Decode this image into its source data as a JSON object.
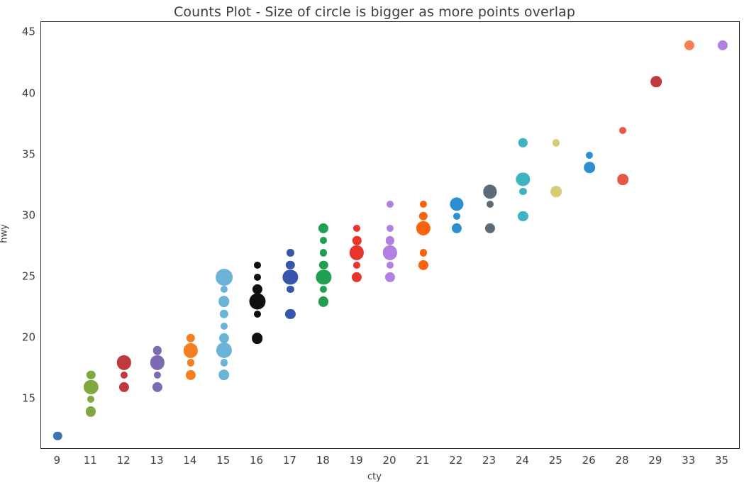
{
  "chart_data": {
    "type": "scatter",
    "title": "Counts Plot - Size of circle is bigger as more points overlap",
    "xlabel": "cty",
    "ylabel": "hwy",
    "grid": false,
    "legend": false,
    "x_is_categorical": true,
    "categories": [
      "9",
      "11",
      "12",
      "13",
      "14",
      "15",
      "16",
      "17",
      "18",
      "19",
      "20",
      "21",
      "22",
      "23",
      "24",
      "25",
      "26",
      "28",
      "29",
      "33",
      "35"
    ],
    "xtick_labels": [
      "9",
      "11",
      "12",
      "13",
      "14",
      "15",
      "16",
      "17",
      "18",
      "19",
      "20",
      "21",
      "22",
      "23",
      "24",
      "25",
      "26",
      "28",
      "29",
      "33",
      "35"
    ],
    "ytick_labels": [
      "15",
      "20",
      "25",
      "30",
      "35",
      "40",
      "45"
    ],
    "yticks": [
      15,
      20,
      25,
      30,
      35,
      40,
      45
    ],
    "ylim": [
      11.0,
      45.9
    ],
    "size_encodes": "count of overlapping points",
    "series": [
      {
        "name": "cty=9",
        "color": "#3b75af",
        "points": [
          {
            "x": "9",
            "y": 12,
            "count": 2
          }
        ]
      },
      {
        "name": "cty=11",
        "color": "#7fa93f",
        "points": [
          {
            "x": "11",
            "y": 17,
            "count": 2
          },
          {
            "x": "11",
            "y": 16,
            "count": 8
          },
          {
            "x": "11",
            "y": 15,
            "count": 1
          },
          {
            "x": "11",
            "y": 14,
            "count": 3
          }
        ]
      },
      {
        "name": "cty=12",
        "color": "#c0393f",
        "points": [
          {
            "x": "12",
            "y": 18,
            "count": 8
          },
          {
            "x": "12",
            "y": 17,
            "count": 1
          },
          {
            "x": "12",
            "y": 16,
            "count": 3
          }
        ]
      },
      {
        "name": "cty=13",
        "color": "#7d6ab2",
        "points": [
          {
            "x": "13",
            "y": 19,
            "count": 2
          },
          {
            "x": "13",
            "y": 18,
            "count": 8
          },
          {
            "x": "13",
            "y": 17,
            "count": 1
          },
          {
            "x": "13",
            "y": 16,
            "count": 3
          }
        ]
      },
      {
        "name": "cty=14",
        "color": "#f57f20",
        "points": [
          {
            "x": "14",
            "y": 20,
            "count": 2
          },
          {
            "x": "14",
            "y": 19,
            "count": 8
          },
          {
            "x": "14",
            "y": 18,
            "count": 1
          },
          {
            "x": "14",
            "y": 17,
            "count": 3
          }
        ]
      },
      {
        "name": "cty=15",
        "color": "#6cb4d7",
        "points": [
          {
            "x": "15",
            "y": 25,
            "count": 12
          },
          {
            "x": "15",
            "y": 24,
            "count": 1
          },
          {
            "x": "15",
            "y": 23,
            "count": 4
          },
          {
            "x": "15",
            "y": 22,
            "count": 2
          },
          {
            "x": "15",
            "y": 21,
            "count": 1
          },
          {
            "x": "15",
            "y": 20,
            "count": 3
          },
          {
            "x": "15",
            "y": 19,
            "count": 10
          },
          {
            "x": "15",
            "y": 18,
            "count": 1
          },
          {
            "x": "15",
            "y": 17,
            "count": 4
          }
        ]
      },
      {
        "name": "cty=16",
        "color": "#101010",
        "points": [
          {
            "x": "16",
            "y": 26,
            "count": 1
          },
          {
            "x": "16",
            "y": 25,
            "count": 1
          },
          {
            "x": "16",
            "y": 24,
            "count": 3
          },
          {
            "x": "16",
            "y": 23,
            "count": 11
          },
          {
            "x": "16",
            "y": 22,
            "count": 1
          },
          {
            "x": "16",
            "y": 20,
            "count": 4
          }
        ]
      },
      {
        "name": "cty=17",
        "color": "#3656ac",
        "points": [
          {
            "x": "17",
            "y": 27,
            "count": 1
          },
          {
            "x": "17",
            "y": 26,
            "count": 2
          },
          {
            "x": "17",
            "y": 25,
            "count": 9
          },
          {
            "x": "17",
            "y": 24,
            "count": 1
          },
          {
            "x": "17",
            "y": 22,
            "count": 3
          }
        ]
      },
      {
        "name": "cty=18",
        "color": "#22a052",
        "points": [
          {
            "x": "18",
            "y": 29,
            "count": 3
          },
          {
            "x": "18",
            "y": 28,
            "count": 1
          },
          {
            "x": "18",
            "y": 27,
            "count": 1
          },
          {
            "x": "18",
            "y": 26,
            "count": 2
          },
          {
            "x": "18",
            "y": 25,
            "count": 9
          },
          {
            "x": "18",
            "y": 24,
            "count": 1
          },
          {
            "x": "18",
            "y": 23,
            "count": 3
          }
        ]
      },
      {
        "name": "cty=19",
        "color": "#e8342a",
        "points": [
          {
            "x": "19",
            "y": 29,
            "count": 1
          },
          {
            "x": "19",
            "y": 28,
            "count": 2
          },
          {
            "x": "19",
            "y": 27,
            "count": 8
          },
          {
            "x": "19",
            "y": 26,
            "count": 1
          },
          {
            "x": "19",
            "y": 25,
            "count": 3
          }
        ]
      },
      {
        "name": "cty=20",
        "color": "#b280e0",
        "points": [
          {
            "x": "20",
            "y": 31,
            "count": 1
          },
          {
            "x": "20",
            "y": 29,
            "count": 1
          },
          {
            "x": "20",
            "y": 28,
            "count": 2
          },
          {
            "x": "20",
            "y": 27,
            "count": 8
          },
          {
            "x": "20",
            "y": 26,
            "count": 1
          },
          {
            "x": "20",
            "y": 25,
            "count": 3
          }
        ]
      },
      {
        "name": "cty=21",
        "color": "#f8630c",
        "points": [
          {
            "x": "21",
            "y": 31,
            "count": 1
          },
          {
            "x": "21",
            "y": 30,
            "count": 2
          },
          {
            "x": "21",
            "y": 29,
            "count": 8
          },
          {
            "x": "21",
            "y": 27,
            "count": 1
          },
          {
            "x": "21",
            "y": 26,
            "count": 3
          }
        ]
      },
      {
        "name": "cty=22",
        "color": "#2e8fd0",
        "points": [
          {
            "x": "22",
            "y": 31,
            "count": 7
          },
          {
            "x": "22",
            "y": 30,
            "count": 1
          },
          {
            "x": "22",
            "y": 29,
            "count": 3
          }
        ]
      },
      {
        "name": "cty=23",
        "color": "#5b6b78",
        "points": [
          {
            "x": "23",
            "y": 32,
            "count": 7
          },
          {
            "x": "23",
            "y": 31,
            "count": 1
          },
          {
            "x": "23",
            "y": 29,
            "count": 3
          }
        ]
      },
      {
        "name": "cty=24",
        "color": "#3fb3bf",
        "points": [
          {
            "x": "24",
            "y": 36,
            "count": 2
          },
          {
            "x": "24",
            "y": 33,
            "count": 7
          },
          {
            "x": "24",
            "y": 32,
            "count": 1
          },
          {
            "x": "24",
            "y": 30,
            "count": 3
          }
        ]
      },
      {
        "name": "cty=25",
        "color": "#d8cb78",
        "points": [
          {
            "x": "25",
            "y": 36,
            "count": 1
          },
          {
            "x": "25",
            "y": 32,
            "count": 4
          }
        ]
      },
      {
        "name": "cty=26",
        "color": "#2e8fd0",
        "points": [
          {
            "x": "26",
            "y": 35,
            "count": 1
          },
          {
            "x": "26",
            "y": 34,
            "count": 4
          }
        ]
      },
      {
        "name": "cty=28",
        "color": "#e8564a",
        "points": [
          {
            "x": "28",
            "y": 37,
            "count": 1
          },
          {
            "x": "28",
            "y": 33,
            "count": 4
          }
        ]
      },
      {
        "name": "cty=29",
        "color": "#c0393f",
        "points": [
          {
            "x": "29",
            "y": 41,
            "count": 4
          }
        ]
      },
      {
        "name": "cty=33",
        "color": "#fa8156",
        "points": [
          {
            "x": "33",
            "y": 44,
            "count": 3
          }
        ]
      },
      {
        "name": "cty=35",
        "color": "#b280e0",
        "points": [
          {
            "x": "35",
            "y": 44,
            "count": 3
          }
        ]
      }
    ]
  }
}
